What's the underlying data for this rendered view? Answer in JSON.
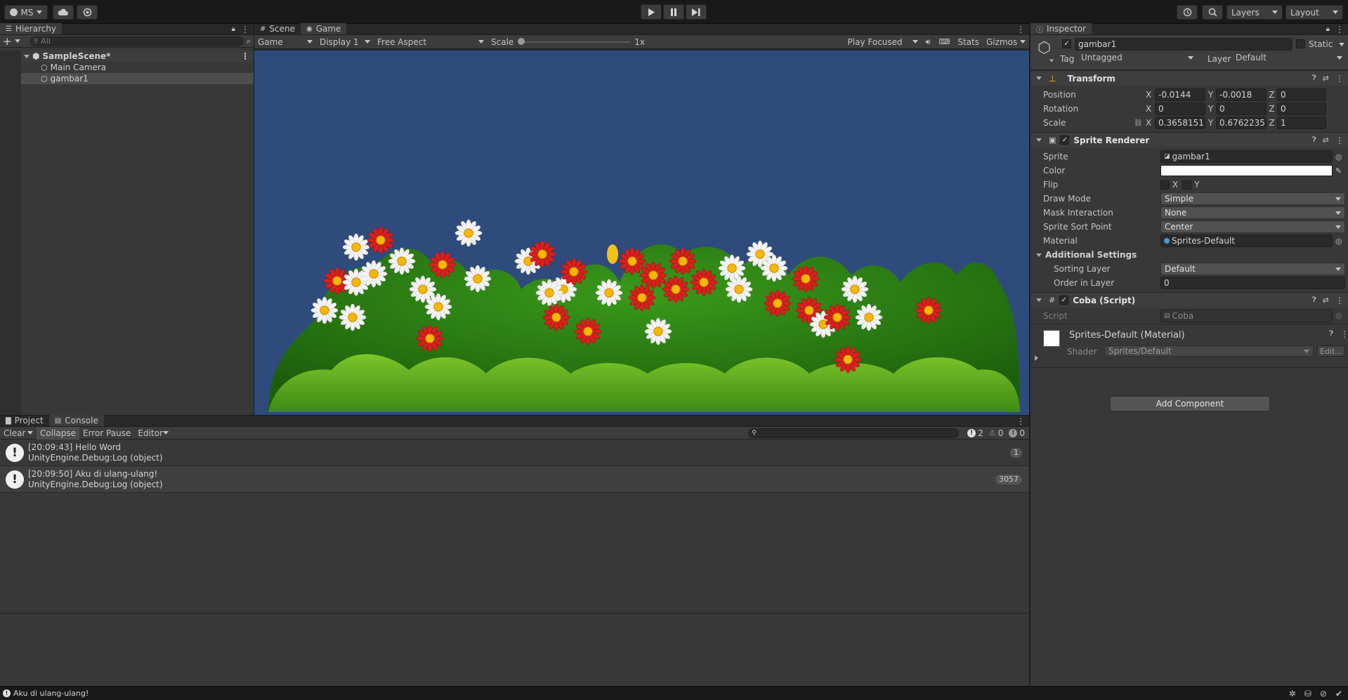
{
  "toolbar": {
    "account_label": "MS",
    "layers_label": "Layers",
    "layout_label": "Layout"
  },
  "hierarchy": {
    "tab_label": "Hierarchy",
    "search_placeholder": "All",
    "scene_name": "SampleScene*",
    "items": [
      {
        "label": "Main Camera"
      },
      {
        "label": "gambar1"
      }
    ]
  },
  "game_view": {
    "tabs": [
      {
        "label": "Scene"
      },
      {
        "label": "Game"
      }
    ],
    "game_dropdown": "Game",
    "display_dropdown": "Display 1",
    "aspect_dropdown": "Free Aspect",
    "scale_label": "Scale",
    "scale_value": "1x",
    "scale_fraction": 0.0,
    "play_mode_dropdown": "Play Focused",
    "stats_label": "Stats",
    "gizmos_label": "Gizmos",
    "background_color": "#2f4b7c"
  },
  "console": {
    "tabs": [
      {
        "label": "Project"
      },
      {
        "label": "Console"
      }
    ],
    "clear_label": "Clear",
    "collapse_label": "Collapse",
    "error_pause_label": "Error Pause",
    "editor_label": "Editor",
    "info_count": "2",
    "warn_count": "0",
    "error_count": "0",
    "logs": [
      {
        "line1": "[20:09:43] Hello Word",
        "line2": "UnityEngine.Debug:Log (object)",
        "count": "1"
      },
      {
        "line1": "[20:09:50] Aku di ulang-ulang!",
        "line2": "UnityEngine.Debug:Log (object)",
        "count": "3057"
      }
    ]
  },
  "inspector": {
    "tab_label": "Inspector",
    "object_name": "gambar1",
    "static_label": "Static",
    "tag_label": "Tag",
    "tag_value": "Untagged",
    "layer_label": "Layer",
    "layer_value": "Default",
    "transform": {
      "title": "Transform",
      "position_label": "Position",
      "rotation_label": "Rotation",
      "scale_label": "Scale",
      "position": {
        "x": "-0.0144",
        "y": "-0.0018",
        "z": "0"
      },
      "rotation": {
        "x": "0",
        "y": "0",
        "z": "0"
      },
      "scale": {
        "x": "0.3658151",
        "y": "0.6762235",
        "z": "1"
      }
    },
    "sprite_renderer": {
      "title": "Sprite Renderer",
      "sprite_label": "Sprite",
      "sprite_value": "gambar1",
      "color_label": "Color",
      "color_value": "#ffffff",
      "flip_label": "Flip",
      "flip_x": "X",
      "flip_y": "Y",
      "draw_mode_label": "Draw Mode",
      "draw_mode_value": "Simple",
      "mask_label": "Mask Interaction",
      "mask_value": "None",
      "sort_point_label": "Sprite Sort Point",
      "sort_point_value": "Center",
      "material_label": "Material",
      "material_value": "Sprites-Default",
      "additional_label": "Additional Settings",
      "sorting_layer_label": "Sorting Layer",
      "sorting_layer_value": "Default",
      "order_label": "Order in Layer",
      "order_value": "0"
    },
    "script_comp": {
      "title": "Coba (Script)",
      "script_label": "Script",
      "script_value": "Coba"
    },
    "material": {
      "title": "Sprites-Default (Material)",
      "shader_label": "Shader",
      "shader_value": "Sprites/Default",
      "edit_label": "Edit..."
    },
    "add_component_label": "Add Component"
  },
  "status_bar": {
    "message": "Aku di ulang-ulang!"
  }
}
